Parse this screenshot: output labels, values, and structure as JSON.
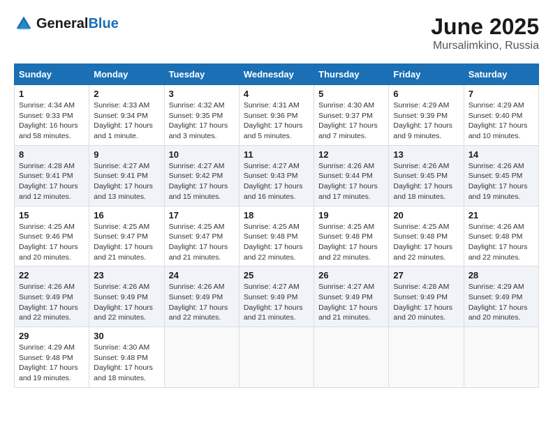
{
  "header": {
    "logo_general": "General",
    "logo_blue": "Blue",
    "title": "June 2025",
    "location": "Mursalimkino, Russia"
  },
  "calendar": {
    "columns": [
      "Sunday",
      "Monday",
      "Tuesday",
      "Wednesday",
      "Thursday",
      "Friday",
      "Saturday"
    ],
    "rows": [
      [
        {
          "day": "1",
          "sunrise": "4:34 AM",
          "sunset": "9:33 PM",
          "daylight": "16 hours and 58 minutes."
        },
        {
          "day": "2",
          "sunrise": "4:33 AM",
          "sunset": "9:34 PM",
          "daylight": "17 hours and 1 minute."
        },
        {
          "day": "3",
          "sunrise": "4:32 AM",
          "sunset": "9:35 PM",
          "daylight": "17 hours and 3 minutes."
        },
        {
          "day": "4",
          "sunrise": "4:31 AM",
          "sunset": "9:36 PM",
          "daylight": "17 hours and 5 minutes."
        },
        {
          "day": "5",
          "sunrise": "4:30 AM",
          "sunset": "9:37 PM",
          "daylight": "17 hours and 7 minutes."
        },
        {
          "day": "6",
          "sunrise": "4:29 AM",
          "sunset": "9:39 PM",
          "daylight": "17 hours and 9 minutes."
        },
        {
          "day": "7",
          "sunrise": "4:29 AM",
          "sunset": "9:40 PM",
          "daylight": "17 hours and 10 minutes."
        }
      ],
      [
        {
          "day": "8",
          "sunrise": "4:28 AM",
          "sunset": "9:41 PM",
          "daylight": "17 hours and 12 minutes."
        },
        {
          "day": "9",
          "sunrise": "4:27 AM",
          "sunset": "9:41 PM",
          "daylight": "17 hours and 13 minutes."
        },
        {
          "day": "10",
          "sunrise": "4:27 AM",
          "sunset": "9:42 PM",
          "daylight": "17 hours and 15 minutes."
        },
        {
          "day": "11",
          "sunrise": "4:27 AM",
          "sunset": "9:43 PM",
          "daylight": "17 hours and 16 minutes."
        },
        {
          "day": "12",
          "sunrise": "4:26 AM",
          "sunset": "9:44 PM",
          "daylight": "17 hours and 17 minutes."
        },
        {
          "day": "13",
          "sunrise": "4:26 AM",
          "sunset": "9:45 PM",
          "daylight": "17 hours and 18 minutes."
        },
        {
          "day": "14",
          "sunrise": "4:26 AM",
          "sunset": "9:45 PM",
          "daylight": "17 hours and 19 minutes."
        }
      ],
      [
        {
          "day": "15",
          "sunrise": "4:25 AM",
          "sunset": "9:46 PM",
          "daylight": "17 hours and 20 minutes."
        },
        {
          "day": "16",
          "sunrise": "4:25 AM",
          "sunset": "9:47 PM",
          "daylight": "17 hours and 21 minutes."
        },
        {
          "day": "17",
          "sunrise": "4:25 AM",
          "sunset": "9:47 PM",
          "daylight": "17 hours and 21 minutes."
        },
        {
          "day": "18",
          "sunrise": "4:25 AM",
          "sunset": "9:48 PM",
          "daylight": "17 hours and 22 minutes."
        },
        {
          "day": "19",
          "sunrise": "4:25 AM",
          "sunset": "9:48 PM",
          "daylight": "17 hours and 22 minutes."
        },
        {
          "day": "20",
          "sunrise": "4:25 AM",
          "sunset": "9:48 PM",
          "daylight": "17 hours and 22 minutes."
        },
        {
          "day": "21",
          "sunrise": "4:26 AM",
          "sunset": "9:48 PM",
          "daylight": "17 hours and 22 minutes."
        }
      ],
      [
        {
          "day": "22",
          "sunrise": "4:26 AM",
          "sunset": "9:49 PM",
          "daylight": "17 hours and 22 minutes."
        },
        {
          "day": "23",
          "sunrise": "4:26 AM",
          "sunset": "9:49 PM",
          "daylight": "17 hours and 22 minutes."
        },
        {
          "day": "24",
          "sunrise": "4:26 AM",
          "sunset": "9:49 PM",
          "daylight": "17 hours and 22 minutes."
        },
        {
          "day": "25",
          "sunrise": "4:27 AM",
          "sunset": "9:49 PM",
          "daylight": "17 hours and 21 minutes."
        },
        {
          "day": "26",
          "sunrise": "4:27 AM",
          "sunset": "9:49 PM",
          "daylight": "17 hours and 21 minutes."
        },
        {
          "day": "27",
          "sunrise": "4:28 AM",
          "sunset": "9:49 PM",
          "daylight": "17 hours and 20 minutes."
        },
        {
          "day": "28",
          "sunrise": "4:29 AM",
          "sunset": "9:49 PM",
          "daylight": "17 hours and 20 minutes."
        }
      ],
      [
        {
          "day": "29",
          "sunrise": "4:29 AM",
          "sunset": "9:48 PM",
          "daylight": "17 hours and 19 minutes."
        },
        {
          "day": "30",
          "sunrise": "4:30 AM",
          "sunset": "9:48 PM",
          "daylight": "17 hours and 18 minutes."
        },
        null,
        null,
        null,
        null,
        null
      ]
    ]
  }
}
